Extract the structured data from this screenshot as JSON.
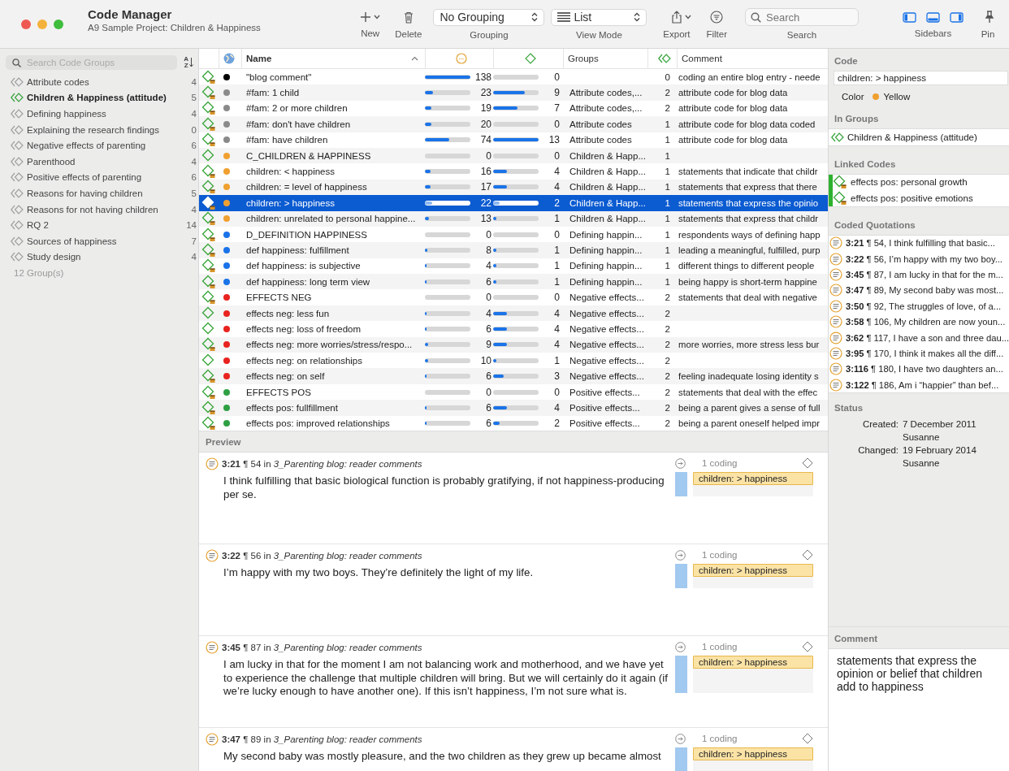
{
  "window": {
    "title": "Code Manager",
    "subtitle": "A9 Sample Project: Children & Happiness"
  },
  "toolbar": {
    "new": {
      "label": "New"
    },
    "delete": {
      "label": "Delete"
    },
    "grouping": {
      "value": "No Grouping",
      "label": "Grouping"
    },
    "view_mode": {
      "value": "List",
      "label": "View Mode"
    },
    "export": {
      "label": "Export"
    },
    "filter": {
      "label": "Filter"
    },
    "search": {
      "placeholder": "Search",
      "label": "Search"
    },
    "sidebars": {
      "label": "Sidebars"
    },
    "pin": {
      "label": "Pin"
    }
  },
  "sidebar": {
    "search": {
      "placeholder": "Search Code Groups"
    },
    "sort_letters": [
      "A",
      "Z"
    ],
    "groups": [
      {
        "name": "Attribute codes",
        "count": "4",
        "selected": false
      },
      {
        "name": "Children & Happiness (attitude)",
        "count": "5",
        "selected": true
      },
      {
        "name": "Defining happiness",
        "count": "4",
        "selected": false
      },
      {
        "name": "Explaining the research findings",
        "count": "0",
        "selected": false
      },
      {
        "name": "Negative effects of parenting",
        "count": "6",
        "selected": false
      },
      {
        "name": "Parenthood",
        "count": "4",
        "selected": false
      },
      {
        "name": "Positive effects of parenting",
        "count": "6",
        "selected": false
      },
      {
        "name": "Reasons for having children",
        "count": "5",
        "selected": false
      },
      {
        "name": "Reasons for not having children",
        "count": "4",
        "selected": false
      },
      {
        "name": "RQ 2",
        "count": "14",
        "selected": false
      },
      {
        "name": "Sources of happiness",
        "count": "7",
        "selected": false
      },
      {
        "name": "Study design",
        "count": "4",
        "selected": false
      }
    ],
    "footer": "12 Group(s)"
  },
  "table": {
    "columns": {
      "name": "Name",
      "groups": "Groups",
      "comment": "Comment"
    },
    "rows": [
      {
        "name": "\"blog comment\"",
        "color": "#000000",
        "quotations": {
          "count": "138",
          "level": 1
        },
        "column_5": {
          "count": "0",
          "level": 0
        },
        "groups": "",
        "group_count": "0",
        "comment": "coding an entire blog entry - neede",
        "selected": false
      },
      {
        "name": "#fam: 1 child",
        "color": "#8a8a8a",
        "quotations": {
          "count": "23",
          "level": 0.17
        },
        "column_5": {
          "count": "9",
          "level": 0.69
        },
        "groups": "Attribute codes,...",
        "group_count": "2",
        "comment": "attribute code for blog data",
        "selected": false
      },
      {
        "name": "#fam: 2 or more  children",
        "color": "#8a8a8a",
        "quotations": {
          "count": "19",
          "level": 0.14
        },
        "column_5": {
          "count": "7",
          "level": 0.54
        },
        "groups": "Attribute codes,...",
        "group_count": "2",
        "comment": "attribute code for blog data",
        "selected": false
      },
      {
        "name": "#fam: don't have children",
        "color": "#8a8a8a",
        "quotations": {
          "count": "20",
          "level": 0.14
        },
        "column_5": {
          "count": "0",
          "level": 0
        },
        "groups": "Attribute codes",
        "group_count": "1",
        "comment": "attribute code for blog data coded",
        "selected": false
      },
      {
        "name": "#fam: have children",
        "color": "#8a8a8a",
        "quotations": {
          "count": "74",
          "level": 0.54
        },
        "column_5": {
          "count": "13",
          "level": 1
        },
        "groups": "Attribute codes",
        "group_count": "1",
        "comment": "attribute code for blog data",
        "selected": false
      },
      {
        "name": "C_CHILDREN & HAPPINESS",
        "color": "#f0a030",
        "quotations": {
          "count": "0",
          "level": 0
        },
        "column_5": {
          "count": "0",
          "level": 0
        },
        "groups": "Children & Happ...",
        "group_count": "1",
        "comment": "",
        "selected": false
      },
      {
        "name": "children: < happiness",
        "color": "#f0a030",
        "quotations": {
          "count": "16",
          "level": 0.12
        },
        "column_5": {
          "count": "4",
          "level": 0.31
        },
        "groups": "Children & Happ...",
        "group_count": "1",
        "comment": "statements that indicate that childr",
        "selected": false
      },
      {
        "name": "children: = level of happiness",
        "color": "#f0a030",
        "quotations": {
          "count": "17",
          "level": 0.12
        },
        "column_5": {
          "count": "4",
          "level": 0.31
        },
        "groups": "Children & Happ...",
        "group_count": "1",
        "comment": "statements that express that there",
        "selected": false
      },
      {
        "name": "children: > happiness",
        "color": "#f0a030",
        "quotations": {
          "count": "22",
          "level": 0.16
        },
        "column_5": {
          "count": "2",
          "level": 0.15
        },
        "groups": "Children & Happ...",
        "group_count": "1",
        "comment": "statements that express the opinio",
        "selected": true
      },
      {
        "name": "children: unrelated to personal happine...",
        "color": "#f0a030",
        "quotations": {
          "count": "13",
          "level": 0.09
        },
        "column_5": {
          "count": "1",
          "level": 0.08
        },
        "groups": "Children & Happ...",
        "group_count": "1",
        "comment": "statements that express that childr",
        "selected": false
      },
      {
        "name": "D_DEFINITION HAPPINESS",
        "color": "#1a73e8",
        "quotations": {
          "count": "0",
          "level": 0
        },
        "column_5": {
          "count": "0",
          "level": 0
        },
        "groups": "Defining happin...",
        "group_count": "1",
        "comment": "respondents ways of defining happ",
        "selected": false
      },
      {
        "name": "def happiness: fulfillment",
        "color": "#1a73e8",
        "quotations": {
          "count": "8",
          "level": 0.06
        },
        "column_5": {
          "count": "1",
          "level": 0.08
        },
        "groups": "Defining happin...",
        "group_count": "1",
        "comment": "leading a meaningful, fulfilled, purp",
        "selected": false
      },
      {
        "name": "def happiness: is subjective",
        "color": "#1a73e8",
        "quotations": {
          "count": "4",
          "level": 0.03
        },
        "column_5": {
          "count": "1",
          "level": 0.08
        },
        "groups": "Defining happin...",
        "group_count": "1",
        "comment": "different things to different people",
        "selected": false
      },
      {
        "name": "def happiness: long term view",
        "color": "#1a73e8",
        "quotations": {
          "count": "6",
          "level": 0.04
        },
        "column_5": {
          "count": "1",
          "level": 0.08
        },
        "groups": "Defining happin...",
        "group_count": "1",
        "comment": "being happy is short-term happine",
        "selected": false
      },
      {
        "name": "EFFECTS NEG",
        "color": "#e8231f",
        "quotations": {
          "count": "0",
          "level": 0
        },
        "column_5": {
          "count": "0",
          "level": 0
        },
        "groups": "Negative effects...",
        "group_count": "2",
        "comment": "statements that deal with negative",
        "selected": false
      },
      {
        "name": "effects neg: less fun",
        "color": "#e8231f",
        "quotations": {
          "count": "4",
          "level": 0.03
        },
        "column_5": {
          "count": "4",
          "level": 0.31
        },
        "groups": "Negative effects...",
        "group_count": "2",
        "comment": "",
        "selected": false
      },
      {
        "name": "effects neg: loss of freedom",
        "color": "#e8231f",
        "quotations": {
          "count": "6",
          "level": 0.04
        },
        "column_5": {
          "count": "4",
          "level": 0.31
        },
        "groups": "Negative effects...",
        "group_count": "2",
        "comment": "",
        "selected": false
      },
      {
        "name": "effects neg: more worries/stress/respo...",
        "color": "#e8231f",
        "quotations": {
          "count": "9",
          "level": 0.07
        },
        "column_5": {
          "count": "4",
          "level": 0.31
        },
        "groups": "Negative effects...",
        "group_count": "2",
        "comment": "more worries, more stress less bur",
        "selected": false
      },
      {
        "name": "effects neg: on relationships",
        "color": "#e8231f",
        "quotations": {
          "count": "10",
          "level": 0.07
        },
        "column_5": {
          "count": "1",
          "level": 0.08
        },
        "groups": "Negative effects...",
        "group_count": "2",
        "comment": "",
        "selected": false
      },
      {
        "name": "effects neg: on self",
        "color": "#e8231f",
        "quotations": {
          "count": "6",
          "level": 0.04
        },
        "column_5": {
          "count": "3",
          "level": 0.23
        },
        "groups": "Negative effects...",
        "group_count": "2",
        "comment": "feeling inadequate losing identity s",
        "selected": false
      },
      {
        "name": "EFFECTS POS",
        "color": "#2ea043",
        "quotations": {
          "count": "0",
          "level": 0
        },
        "column_5": {
          "count": "0",
          "level": 0
        },
        "groups": "Positive effects...",
        "group_count": "2",
        "comment": "statements that deal with the effec",
        "selected": false
      },
      {
        "name": "effects pos: fullfillment",
        "color": "#2ea043",
        "quotations": {
          "count": "6",
          "level": 0.04
        },
        "column_5": {
          "count": "4",
          "level": 0.31
        },
        "groups": "Positive effects...",
        "group_count": "2",
        "comment": "being a parent gives a sense of full",
        "selected": false
      },
      {
        "name": "effects pos: improved relationships",
        "color": "#2ea043",
        "quotations": {
          "count": "6",
          "level": 0.04
        },
        "column_5": {
          "count": "2",
          "level": 0.15
        },
        "groups": "Positive effects...",
        "group_count": "2",
        "comment": "being a parent oneself helped impr",
        "selected": false
      }
    ]
  },
  "preview": {
    "heading": "Preview",
    "quotations": [
      {
        "header": "**3:21** ¶ 54 in *3_Parenting blog: reader comments*",
        "text": "I think fulfilling that basic biological function is probably gratifying, if not happiness-producing per se.",
        "codings": "1 coding",
        "tag": "children: > happiness"
      },
      {
        "header": "**3:22** ¶ 56 in *3_Parenting blog: reader comments*",
        "text": "I’m happy with my two boys. They’re definitely the light of my life.",
        "codings": "1 coding",
        "tag": "children: > happiness"
      },
      {
        "header": "**3:45** ¶ 87 in *3_Parenting blog: reader comments*",
        "text": "I am lucky in that for the moment I am not balancing work and motherhood, and we have yet to experience the challenge that multiple children will bring. But we will certainly do it again (if we’re lucky enough to have another one). If this isn’t happiness, I’m not sure what is.",
        "codings": "1 coding",
        "tag": "children: > happiness"
      },
      {
        "header": "**3:47** ¶ 89 in *3_Parenting blog: reader comments*",
        "text": " My second baby was mostly pleasure, and the two children as they grew up became almost",
        "codings": "1 coding",
        "tag": "children: > happiness"
      }
    ]
  },
  "inspector": {
    "code": {
      "heading": "Code",
      "name": "children: > happiness",
      "color_label": "Color",
      "color": "#f0a030",
      "color_name": "Yellow"
    },
    "in_groups": {
      "heading": "In Groups",
      "items": [
        "Children & Happiness (attitude)"
      ]
    },
    "linked_codes": {
      "heading": "Linked Codes",
      "items": [
        "effects pos: personal growth",
        "effects pos: positive emotions"
      ]
    },
    "coded_quotations": {
      "heading": "Coded Quotations",
      "items": [
        "**3:21** ¶ 54, I think fulfilling that basic...",
        "**3:22** ¶ 56, I’m happy with my two boy...",
        "**3:45** ¶ 87, I am lucky in that for the m...",
        "**3:47** ¶ 89, My second baby was most...",
        "**3:50** ¶ 92, The struggles of love, of a...",
        "**3:58** ¶ 106, My children are now youn...",
        "**3:62** ¶ 117, I have a son and three dau...",
        "**3:95** ¶ 170, I think it makes all the diff...",
        "**3:116** ¶ 180, I have two daughters an...",
        "**3:122** ¶ 186, Am i “happier” than bef..."
      ]
    },
    "status": {
      "heading": "Status",
      "created_label": "Created:",
      "created": "7 December 2011",
      "created_by": "Susanne",
      "changed_label": "Changed:",
      "changed": "19 February 2014",
      "changed_by": "Susanne"
    },
    "comment": {
      "heading": "Comment",
      "text": "statements that express the opinion or belief that children add to happiness"
    }
  }
}
